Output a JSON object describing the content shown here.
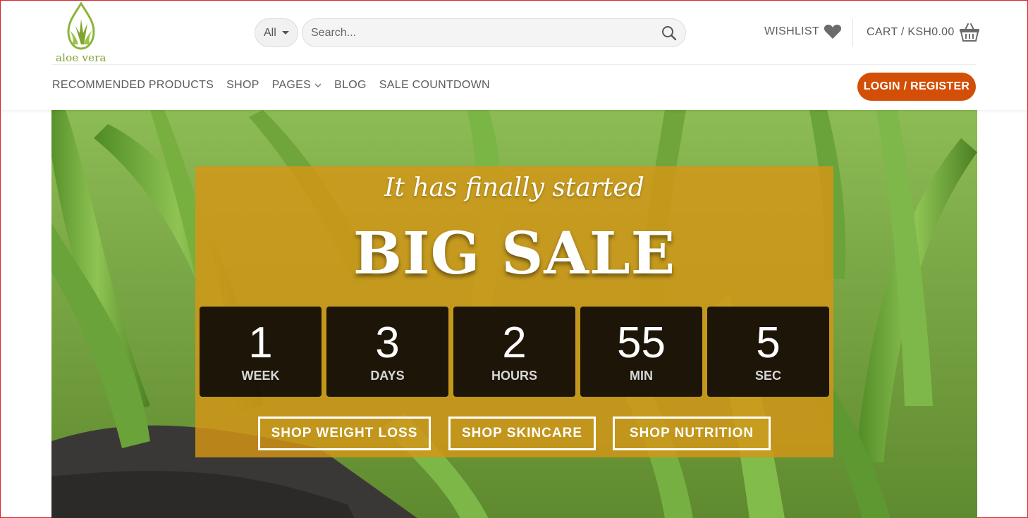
{
  "logo": {
    "text": "aloe vera"
  },
  "search": {
    "category_selected": "All",
    "placeholder": "Search..."
  },
  "header": {
    "wishlist_label": "WISHLIST",
    "cart_label": "CART / KSH0.00",
    "login_label": "LOGIN / REGISTER"
  },
  "nav": {
    "items": [
      {
        "label": "RECOMMENDED PRODUCTS"
      },
      {
        "label": "SHOP"
      },
      {
        "label": "PAGES"
      },
      {
        "label": "BLOG"
      },
      {
        "label": "SALE COUNTDOWN"
      }
    ]
  },
  "hero": {
    "tagline": "It has finally started",
    "headline": "BIG SALE",
    "countdown": [
      {
        "value": "1",
        "unit": "WEEK"
      },
      {
        "value": "3",
        "unit": "DAYS"
      },
      {
        "value": "2",
        "unit": "HOURS"
      },
      {
        "value": "55",
        "unit": "MIN"
      },
      {
        "value": "5",
        "unit": "SEC"
      }
    ],
    "buttons": [
      {
        "label": "SHOP WEIGHT LOSS"
      },
      {
        "label": "SHOP SKINCARE"
      },
      {
        "label": "SHOP NUTRITION"
      }
    ]
  },
  "colors": {
    "accent": "#d34f07",
    "panel": "#d69616",
    "logo_green": "#7fa52f"
  },
  "icons": [
    "aloe-logo-icon",
    "caret-down-icon",
    "search-icon",
    "heart-icon",
    "basket-icon",
    "chevron-down-icon"
  ]
}
